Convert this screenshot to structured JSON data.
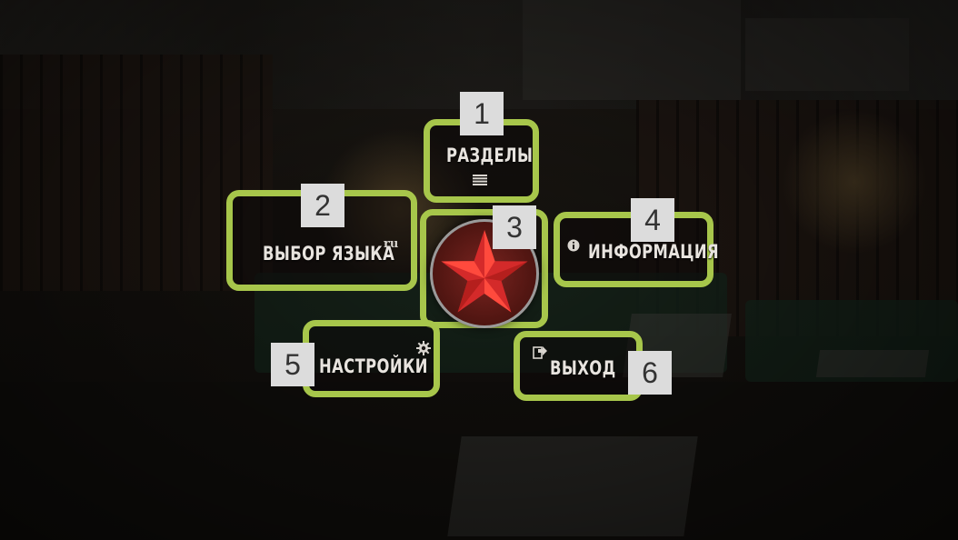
{
  "menu": {
    "sections": {
      "label": "РАЗДЕЛЫ",
      "icon": "list-icon"
    },
    "language": {
      "label": "ВЫБОР ЯЗЫКА",
      "current": "ru"
    },
    "logo": {
      "icon": "red-star-icon"
    },
    "info": {
      "label": "ИНФОРМАЦИЯ",
      "icon": "info-icon"
    },
    "settings": {
      "label": "НАСТРОЙКИ",
      "icon": "gear-icon"
    },
    "exit": {
      "label": "ВЫХОД",
      "icon": "exit-icon"
    }
  },
  "markers": [
    "1",
    "2",
    "3",
    "4",
    "5",
    "6"
  ],
  "colors": {
    "highlight": "#a7c64b",
    "marker_bg": "#dcdcdc",
    "star": "#d42a2a"
  }
}
